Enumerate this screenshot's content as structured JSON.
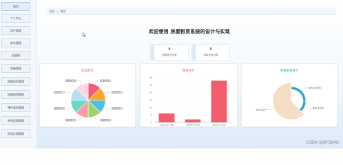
{
  "sidebar": {
    "items": [
      {
        "label": "首页"
      },
      {
        "label": "个人中心"
      },
      {
        "label": "用户管理"
      },
      {
        "label": "房东管理"
      },
      {
        "label": "区管理"
      },
      {
        "label": "房屋管理"
      },
      {
        "label": "房屋类型管理"
      },
      {
        "label": "房屋租赁管理"
      },
      {
        "label": "预约看房管理"
      },
      {
        "label": "合同信息管理"
      },
      {
        "label": "投诉反馈管理"
      }
    ]
  },
  "breadcrumb": {
    "home": "首页",
    "current": "首页"
  },
  "page_title": "欢迎使用 房屋租赁系统的设计与实现",
  "stats": [
    {
      "value": "8",
      "label": "房屋租赁总数"
    },
    {
      "value": "8",
      "label": "求租信息总数"
    }
  ],
  "colors": {
    "pie": [
      "#f25c7a",
      "#f9a826",
      "#4fc1e9",
      "#a0d468",
      "#ff9ca9",
      "#6ad8c3",
      "#b3e0f2",
      "#ffd6e0"
    ],
    "bar": "#f25c6b",
    "gauge_ring": "#2aa8c9",
    "gauge_fill": "#f5dfc4",
    "title_pink": "#f25c7a",
    "title_blue": "#2aa8c9"
  },
  "chart_data": [
    {
      "type": "pie",
      "title": "房型统计",
      "categories": [
        "房屋类型1",
        "房屋类型2",
        "房屋类型3",
        "房屋类型4",
        "房屋类型5",
        "房屋类型6",
        "房屋类型7",
        "房屋类型8"
      ],
      "values": [
        1,
        1,
        1,
        1,
        1,
        1,
        1,
        1
      ]
    },
    {
      "type": "bar",
      "title": "租金统计",
      "categories": [
        "2022-07-08",
        "2022-07-09",
        "2022-07-15"
      ],
      "values": [
        6,
        2,
        28
      ],
      "yticks": [
        0,
        5,
        10,
        15,
        20,
        25,
        30
      ],
      "ylim": [
        0,
        30
      ]
    },
    {
      "type": "pie",
      "title": "求租租金统计",
      "categories": [
        "3000-4000",
        "800-1000",
        "1000以下"
      ],
      "values": [
        2,
        1,
        5
      ]
    }
  ],
  "watermark": "CSDN @BYSJMG"
}
